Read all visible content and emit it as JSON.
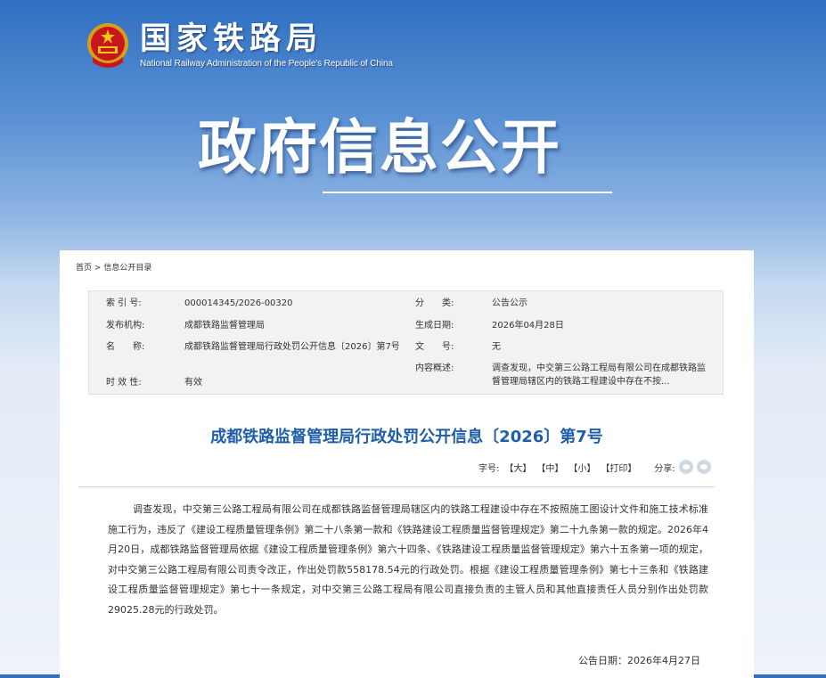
{
  "header": {
    "site_title": "国家铁路局",
    "site_subtitle": "National Railway Administration of the People's Republic of China",
    "emblem_icon": "national-emblem-icon"
  },
  "banner": {
    "title": "政府信息公开"
  },
  "breadcrumb": {
    "home": "首页",
    "separator": ">",
    "current": "信息公开目录"
  },
  "meta": {
    "index_label": "索 引 号:",
    "index_value": "000014345/2026-00320",
    "category_label": "分　　类:",
    "category_value": "公告公示",
    "issuer_label": "发布机构:",
    "issuer_value": "成都铁路监督管理局",
    "created_label": "生成日期:",
    "created_value": "2026年04月28日",
    "name_label": "名　　称:",
    "name_value": "成都铁路监督管理局行政处罚公开信息〔2026〕第7号",
    "docno_label": "文　　号:",
    "docno_value": "无",
    "summary_label": "内容概述:",
    "summary_value": "调查发现，中交第三公路工程局有限公司在成都铁路监督管理局辖区内的铁路工程建设中存在不按...",
    "validity_label": "时 效 性:",
    "validity_value": "有效"
  },
  "article": {
    "title": "成都铁路监督管理局行政处罚公开信息〔2026〕第7号",
    "font_label": "字号:",
    "font_large": "【大】",
    "font_medium": "【中】",
    "font_small": "【小】",
    "print": "【打印】",
    "share_label": "分享:",
    "body": "调查发现，中交第三公路工程局有限公司在成都铁路监督管理局辖区内的铁路工程建设中存在不按照施工图设计文件和施工技术标准施工行为，违反了《建设工程质量管理条例》第二十八条第一款和《铁路建设工程质量监督管理规定》第二十九条第一款的规定。2026年4月20日，成都铁路监督管理局依据《建设工程质量管理条例》第六十四条、《铁路建设工程质量监督管理规定》第六十五条第一项的规定，对中交第三公路工程局有限公司责令改正，作出处罚款558178.54元的行政处罚。根据《建设工程质量管理条例》第七十三条和《铁路建设工程质量监督管理规定》第七十一条规定，对中交第三公路工程局有限公司直接负责的主管人员和其他直接责任人员分别作出处罚款29025.28元的行政处罚。",
    "pub_date": "公告日期：2026年4月27日"
  },
  "colors": {
    "title_blue": "#1f5ea8",
    "banner_top": "#2f6fc0"
  }
}
